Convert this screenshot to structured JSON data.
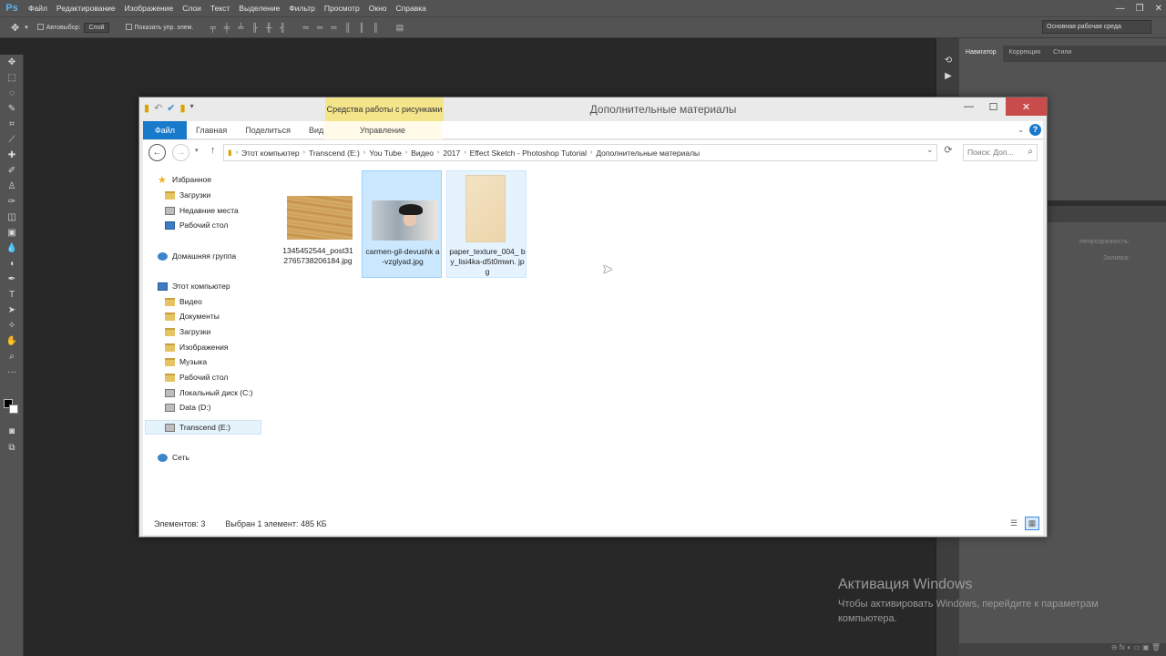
{
  "photoshop": {
    "logo": "Ps",
    "menu": [
      "Файл",
      "Редактирование",
      "Изображение",
      "Слои",
      "Текст",
      "Выделение",
      "Фильтр",
      "Просмотр",
      "Окно",
      "Справка"
    ],
    "options": {
      "autoselect_label": "Автовыбор:",
      "autoselect_value": "Слой",
      "show_transform_label": "Показать упр. элем."
    },
    "workspace": "Основная рабочая среда",
    "panel_tabs": [
      "Навигатор",
      "Коррекция",
      "Стили"
    ],
    "layers": {
      "opacity_label": "Непрозрачность:",
      "fill_label": "Заливка:"
    }
  },
  "explorer": {
    "title": "Дополнительные материалы",
    "context_tools": "Средства работы с рисунками",
    "ribbon_tabs": [
      "Файл",
      "Главная",
      "Поделиться",
      "Вид"
    ],
    "manage_tab": "Управление",
    "breadcrumbs": [
      "Этот компьютер",
      "Transcend (E:)",
      "You Tube",
      "Видео",
      "2017",
      "Effect Sketch - Photoshop Tutorial",
      "Дополнительные материалы"
    ],
    "search_placeholder": "Поиск: Доп...",
    "sidebar": {
      "favorites": "Избранное",
      "fav_items": [
        "Загрузки",
        "Недавние места",
        "Рабочий стол"
      ],
      "homegroup": "Домашняя группа",
      "this_pc": "Этот компьютер",
      "pc_items": [
        "Видео",
        "Документы",
        "Загрузки",
        "Изображения",
        "Музыка",
        "Рабочий стол",
        "Локальный диск (C:)",
        "Data (D:)",
        "Transcend (E:)"
      ],
      "network": "Сеть"
    },
    "files": [
      {
        "name": "1345452544_post312765738206184.jpg",
        "display": "1345452544_post31 2765738206184.jpg"
      },
      {
        "name": "carmen-gil-devushka-vzglyad.jpg",
        "display": "carmen-gil-devushk a-vzglyad.jpg"
      },
      {
        "name": "paper_texture_004_by_lisi4ka-d5t0mwn.jpg",
        "display": "paper_texture_004_ by_lisi4ka-d5t0mwn. jpg"
      }
    ],
    "status": {
      "count": "Элементов: 3",
      "selected": "Выбран 1 элемент: 485 КБ"
    }
  },
  "activation": {
    "title": "Активация Windows",
    "text": "Чтобы активировать Windows, перейдите к параметрам компьютера."
  },
  "icons": {
    "back": "back-arrow-icon",
    "forward": "forward-arrow-icon",
    "up": "up-arrow-icon",
    "refresh": "refresh-icon",
    "search": "search-icon",
    "help": "help-icon"
  },
  "colors": {
    "file_tab": "#1979ca",
    "context_tab": "#f4e58b",
    "close_button": "#c94c4c",
    "selection": "#cce8ff"
  }
}
